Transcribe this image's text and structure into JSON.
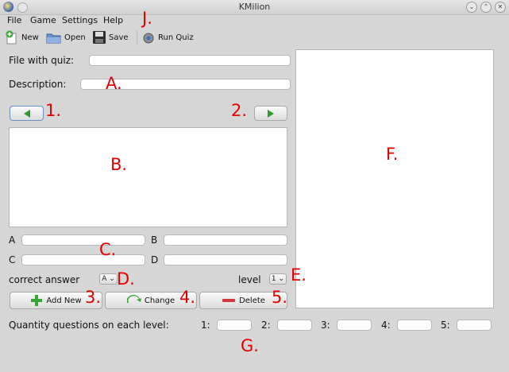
{
  "window": {
    "title": "KMilion"
  },
  "menubar": [
    {
      "label": "File"
    },
    {
      "label": "Game"
    },
    {
      "label": "Settings"
    },
    {
      "label": "Help"
    }
  ],
  "toolbar": {
    "new": "New",
    "open": "Open",
    "save": "Save",
    "run": "Run Quiz"
  },
  "form": {
    "file_label": "File with quiz:",
    "desc_label": "Description:",
    "answer_a": "A",
    "answer_b": "B",
    "answer_c": "C",
    "answer_d": "D",
    "correct_label": "correct answer",
    "correct_value": "A",
    "level_label": "level",
    "level_value": "1",
    "add_label": "Add New",
    "change_label": "Change",
    "delete_label": "Delete",
    "quantity_label": "Quantity questions on each level:",
    "levels": [
      "1:",
      "2:",
      "3:",
      "4:",
      "5:"
    ]
  },
  "annotations": {
    "j": "J.",
    "a": "A.",
    "n1": "1.",
    "n2": "2.",
    "b": "B.",
    "f": "F.",
    "c": "C.",
    "d": "D.",
    "e": "E.",
    "n3": "3.",
    "n4": "4.",
    "n5": "5.",
    "g": "G."
  },
  "colors": {
    "annotation": "#e30000",
    "nav_arrow": "#2e9b2e"
  }
}
